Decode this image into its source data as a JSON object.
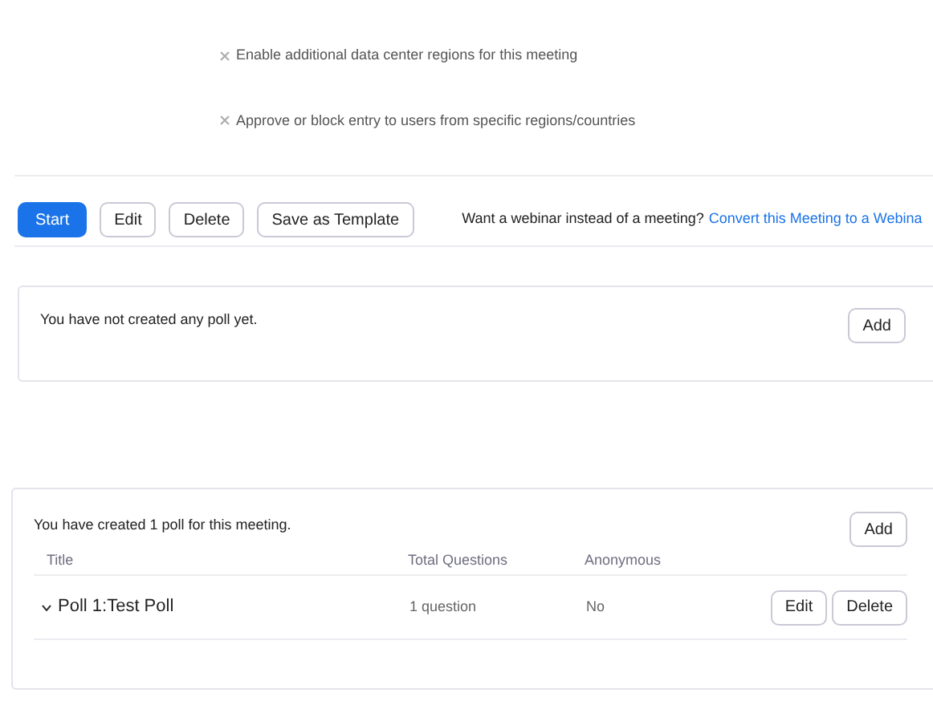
{
  "options": [
    {
      "label": "Enable additional data center regions for this meeting",
      "enabled": false
    },
    {
      "label": "Approve or block entry to users from specific regions/countries",
      "enabled": false
    }
  ],
  "actions": [
    {
      "label": "Start",
      "kind": "primary"
    },
    {
      "label": "Edit",
      "kind": "secondary"
    },
    {
      "label": "Delete",
      "kind": "secondary"
    },
    {
      "label": "Save as Template",
      "kind": "secondary"
    }
  ],
  "webinar_prompt": {
    "text": "Want a webinar instead of a meeting?",
    "link": "Convert this Meeting to a Webina"
  },
  "empty_polls": {
    "message": "You have not created any poll yet.",
    "add_button": "Add"
  },
  "polls": {
    "message": "You have created 1 poll for this meeting.",
    "add_button": "Add",
    "columns": [
      "Title",
      "Total Questions",
      "Anonymous"
    ],
    "rows": [
      {
        "title": "Poll 1:Test Poll",
        "questions": "1 question",
        "anonymous": "No",
        "expanded": false,
        "buttons": [
          "Edit",
          "Delete"
        ]
      }
    ]
  }
}
